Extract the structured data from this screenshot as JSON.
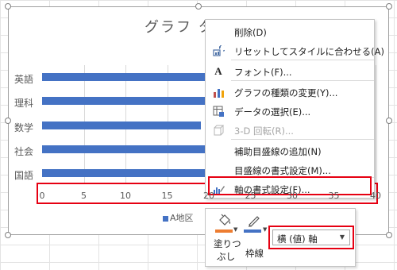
{
  "chart": {
    "title": "グラフ タ",
    "legend_label": "A地区"
  },
  "chart_data": {
    "type": "bar",
    "categories": [
      "英語",
      "理科",
      "数学",
      "社会",
      "国語"
    ],
    "x_ticks": [
      "0",
      "5",
      "10",
      "15",
      "20",
      "25",
      "30",
      "35",
      "40"
    ],
    "xlim": [
      0,
      40
    ],
    "series": [
      {
        "name": "A地区",
        "values": [
          35,
          32,
          19,
          32,
          34
        ]
      }
    ],
    "title": "グラフ タ",
    "legend": "bottom",
    "colors": {
      "series": "#4472c4"
    }
  },
  "context_menu": {
    "items": [
      {
        "label": "削除(D)",
        "icon": "",
        "disabled": false
      },
      {
        "label": "リセットしてスタイルに合わせる(A)",
        "icon": "reset-style-icon",
        "disabled": false
      },
      {
        "label": "フォント(F)...",
        "icon": "font-icon",
        "glyph": "A",
        "disabled": false
      },
      {
        "label": "グラフの種類の変更(Y)...",
        "icon": "chart-type-icon",
        "disabled": false
      },
      {
        "label": "データの選択(E)...",
        "icon": "select-data-icon",
        "disabled": false
      },
      {
        "label": "3-D 回転(R)...",
        "icon": "3d-rotation-icon",
        "disabled": true
      },
      {
        "label": "補助目盛線の追加(N)",
        "icon": "",
        "disabled": false
      },
      {
        "label": "目盛線の書式設定(M)...",
        "icon": "",
        "disabled": false
      },
      {
        "label": "軸の書式設定(F)...",
        "icon": "format-axis-icon",
        "disabled": false
      }
    ]
  },
  "mini_toolbar": {
    "fill_label_1": "塗りつ",
    "fill_label_2": "ぶし",
    "outline_label": "枠線",
    "element_select": "横 (値) 軸"
  },
  "colors": {
    "highlight": "#e60012",
    "series": "#4472c4",
    "accent_orange": "#ed7d31"
  }
}
